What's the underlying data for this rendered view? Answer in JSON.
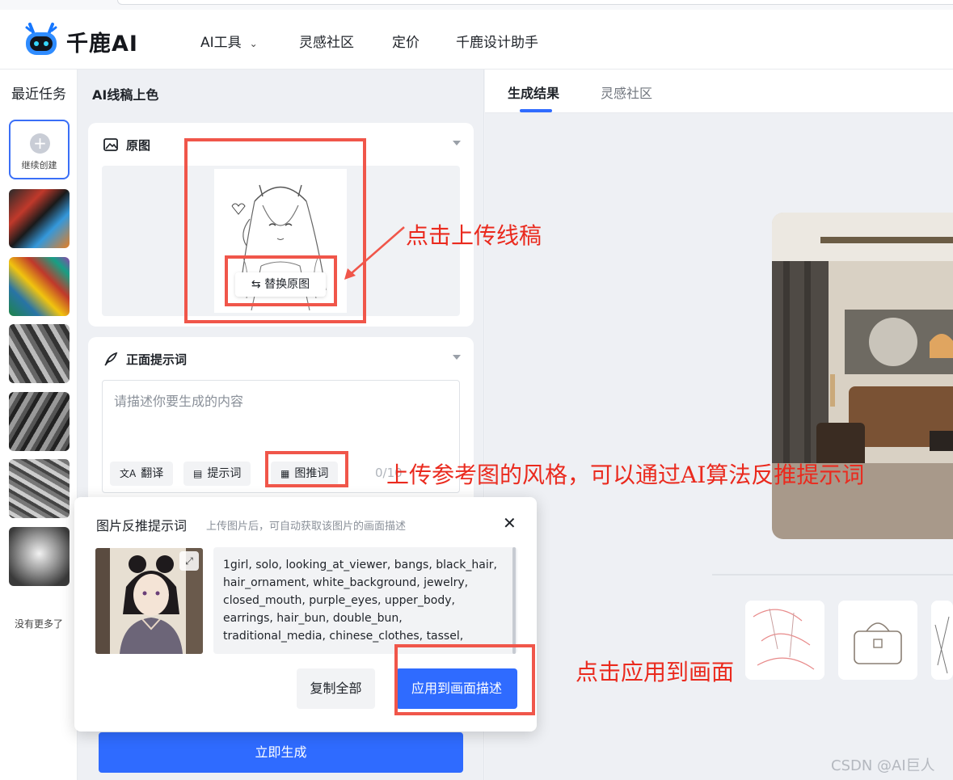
{
  "header": {
    "brand": "千鹿AI",
    "nav": [
      {
        "label": "AI工具",
        "has_dropdown": true
      },
      {
        "label": "灵感社区"
      },
      {
        "label": "定价"
      },
      {
        "label": "千鹿设计助手"
      }
    ]
  },
  "rail": {
    "title": "最近任务",
    "create_label": "继续创建",
    "end_label": "没有更多了"
  },
  "panel": {
    "title": "AI线稿上色",
    "original": {
      "title": "原图",
      "replace_button": "替换原图"
    },
    "prompt": {
      "title": "正面提示词",
      "placeholder": "请描述你要生成的内容",
      "tools": [
        "翻译",
        "提示词",
        "图推词"
      ],
      "counter": "0/10"
    },
    "generate_button": "立即生成"
  },
  "popup": {
    "title": "图片反推提示词",
    "subtitle": "上传图片后，可自动获取该图片的画面描述",
    "tags": "1girl, solo, looking_at_viewer, bangs, black_hair, hair_ornament, white_background, jewelry, closed_mouth, purple_eyes, upper_body, earrings, hair_bun, double_bun, traditional_media, chinese_clothes, tassel,",
    "copy_button": "复制全部",
    "apply_button": "应用到画面描述"
  },
  "result": {
    "tabs": [
      {
        "label": "生成结果",
        "active": true
      },
      {
        "label": "灵感社区",
        "active": false
      }
    ]
  },
  "annotations": {
    "upload": "点击上传线稿",
    "reverse": "上传参考图的风格，可以通过AI算法反推提示词",
    "apply": "点击应用到画面"
  },
  "watermark": "CSDN @AI巨人",
  "colors": {
    "accent": "#2f6bff",
    "annotation": "#ea2a1e"
  }
}
